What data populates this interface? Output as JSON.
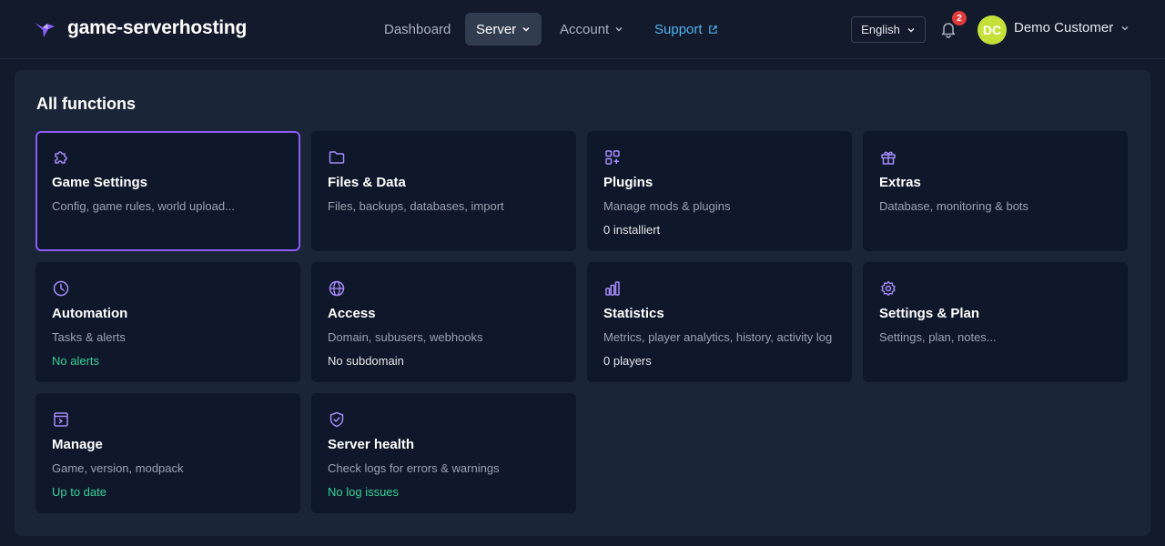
{
  "brand": {
    "name": "game-serverhosting"
  },
  "nav": {
    "dashboard": "Dashboard",
    "server": "Server",
    "account": "Account",
    "support": "Support"
  },
  "language": {
    "selected": "English"
  },
  "notifications": {
    "count": "2"
  },
  "user": {
    "initials": "DC",
    "name": "Demo Customer"
  },
  "colors": {
    "accent": "#8b5cf6",
    "support_link": "#4cb4f0",
    "success": "#34d399",
    "badge": "#e03a3a",
    "avatar": "#c6e03a"
  },
  "panel": {
    "title": "All functions",
    "cards": [
      {
        "title": "Game Settings",
        "desc": "Config, game rules, world upload...",
        "status": "",
        "icon": "puzzle-icon"
      },
      {
        "title": "Files & Data",
        "desc": "Files, backups, databases, import",
        "status": "",
        "icon": "folder-icon"
      },
      {
        "title": "Plugins",
        "desc": "Manage mods & plugins",
        "status": "0 installiert",
        "icon": "apps-add-icon"
      },
      {
        "title": "Extras",
        "desc": "Database, monitoring & bots",
        "status": "",
        "icon": "gift-icon"
      },
      {
        "title": "Automation",
        "desc": "Tasks & alerts",
        "status": "No alerts",
        "icon": "clock-icon"
      },
      {
        "title": "Access",
        "desc": "Domain, subusers, webhooks",
        "status": "No subdomain",
        "icon": "globe-icon"
      },
      {
        "title": "Statistics",
        "desc": "Metrics, player analytics, history, activity log",
        "status": "0 players",
        "icon": "bar-chart-icon"
      },
      {
        "title": "Settings & Plan",
        "desc": "Settings, plan, notes...",
        "status": "",
        "icon": "gear-icon"
      },
      {
        "title": "Manage",
        "desc": "Game, version, modpack",
        "status": "Up to date",
        "icon": "terminal-window-icon"
      },
      {
        "title": "Server health",
        "desc": "Check logs for errors & warnings",
        "status": "No log issues",
        "icon": "shield-check-icon"
      }
    ]
  }
}
